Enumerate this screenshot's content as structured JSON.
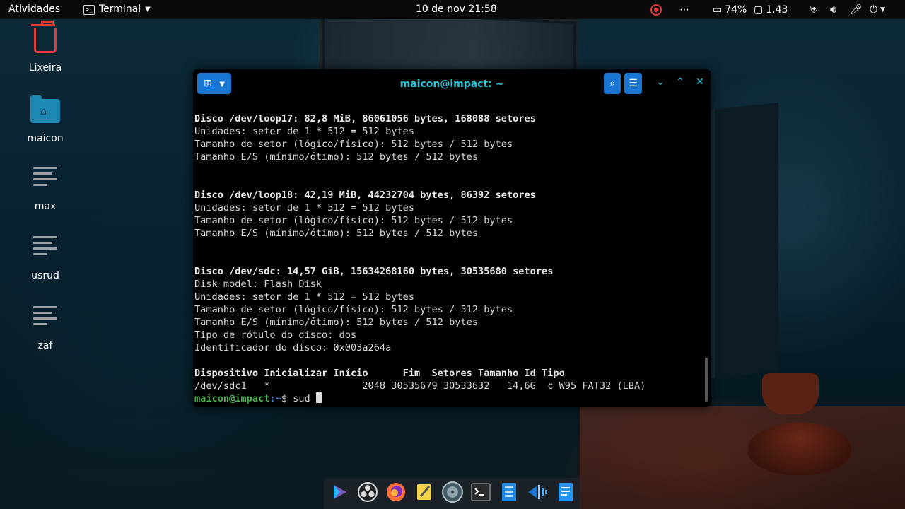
{
  "topbar": {
    "activities": "Atividades",
    "app_name": "Terminal",
    "clock": "10 de nov  21:58",
    "battery": "74%",
    "load": "1.43"
  },
  "desktop": {
    "icons": [
      {
        "label": "Lixeira"
      },
      {
        "label": "maicon"
      },
      {
        "label": "max"
      },
      {
        "label": "usrud"
      },
      {
        "label": "zaf"
      }
    ]
  },
  "terminal": {
    "title": "maicon@impact: ~",
    "lines": [
      "Disco /dev/loop17: 82,8 MiB, 86061056 bytes, 168088 setores",
      "Unidades: setor de 1 * 512 = 512 bytes",
      "Tamanho de setor (lógico/físico): 512 bytes / 512 bytes",
      "Tamanho E/S (mínimo/ótimo): 512 bytes / 512 bytes",
      "",
      "",
      "Disco /dev/loop18: 42,19 MiB, 44232704 bytes, 86392 setores",
      "Unidades: setor de 1 * 512 = 512 bytes",
      "Tamanho de setor (lógico/físico): 512 bytes / 512 bytes",
      "Tamanho E/S (mínimo/ótimo): 512 bytes / 512 bytes",
      "",
      "",
      "Disco /dev/sdc: 14,57 GiB, 15634268160 bytes, 30535680 setores",
      "Disk model: Flash Disk",
      "Unidades: setor de 1 * 512 = 512 bytes",
      "Tamanho de setor (lógico/físico): 512 bytes / 512 bytes",
      "Tamanho E/S (mínimo/ótimo): 512 bytes / 512 bytes",
      "Tipo de rótulo do disco: dos",
      "Identificador do disco: 0x003a264a",
      "",
      "Dispositivo Inicializar Início      Fim  Setores Tamanho Id Tipo",
      "/dev/sdc1   *                2048 30535679 30533632   14,6G  c W95 FAT32 (LBA)"
    ],
    "bold_lines": [
      0,
      6,
      12,
      20
    ],
    "prompt_user": "maicon@impact",
    "prompt_path": ":~",
    "prompt_symbol": "$ ",
    "command_input": "sud"
  },
  "dock": {
    "items": [
      "app-launcher-icon",
      "obs-studio-icon",
      "firefox-icon",
      "text-editor-icon",
      "disk-usage-icon",
      "terminal-icon",
      "files-icon",
      "audio-editor-icon",
      "document-viewer-icon"
    ]
  }
}
